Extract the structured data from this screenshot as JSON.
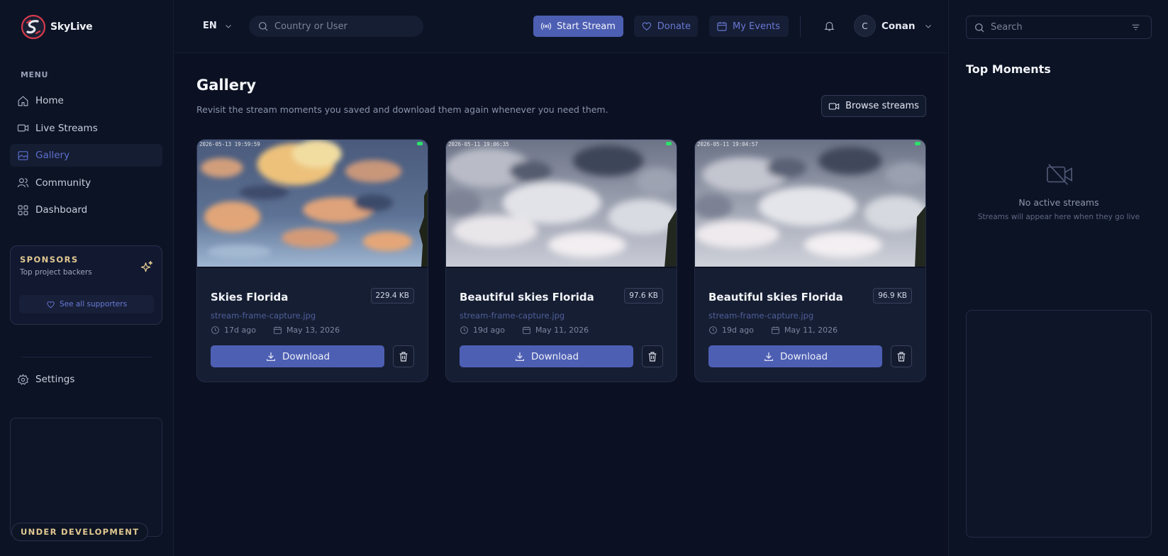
{
  "brand": {
    "name": "SkyLive"
  },
  "sidebar": {
    "menu_title": "MENU",
    "items": [
      {
        "label": "Home",
        "icon": "home-icon",
        "active": false
      },
      {
        "label": "Live Streams",
        "icon": "video-icon",
        "active": false
      },
      {
        "label": "Gallery",
        "icon": "image-icon",
        "active": true
      },
      {
        "label": "Community",
        "icon": "users-icon",
        "active": false
      },
      {
        "label": "Dashboard",
        "icon": "grid-icon",
        "active": false
      }
    ],
    "sponsors": {
      "title": "SPONSORS",
      "subtitle": "Top project backers",
      "button_label": "See all supporters"
    },
    "settings_label": "Settings",
    "dev_badge": "UNDER DEVELOPMENT"
  },
  "header": {
    "language": "EN",
    "search_placeholder": "Country or User",
    "start_stream": "Start Stream",
    "donate": "Donate",
    "my_events": "My Events",
    "user": {
      "initial": "C",
      "name": "Conan"
    }
  },
  "main": {
    "title": "Gallery",
    "subtitle": "Revisit the stream moments you saved and download them again whenever you need them.",
    "browse_button": "Browse streams",
    "download_label": "Download",
    "cards": [
      {
        "title": "Skies Florida",
        "size": "229.4 KB",
        "file": "stream-frame-capture.jpg",
        "ago": "17d ago",
        "date": "May 13, 2026",
        "timestamp": "2026-05-13 19:59:59",
        "sky": "sunset"
      },
      {
        "title": "Beautiful skies Florida",
        "size": "97.6 KB",
        "file": "stream-frame-capture.jpg",
        "ago": "19d ago",
        "date": "May 11, 2026",
        "timestamp": "2026-05-11 19:06:35",
        "sky": "overcast"
      },
      {
        "title": "Beautiful skies Florida",
        "size": "96.9 KB",
        "file": "stream-frame-capture.jpg",
        "ago": "19d ago",
        "date": "May 11, 2026",
        "timestamp": "2026-05-11 19:04:57",
        "sky": "overcast"
      }
    ]
  },
  "right_panel": {
    "search_placeholder": "Search",
    "title": "Top Moments",
    "empty_title": "No active streams",
    "empty_subtitle": "Streams will appear here when they go live"
  },
  "colors": {
    "background": "#0b1122",
    "accent": "#4d5fb3",
    "gold": "#e1c891",
    "live": "#2ee06a"
  }
}
